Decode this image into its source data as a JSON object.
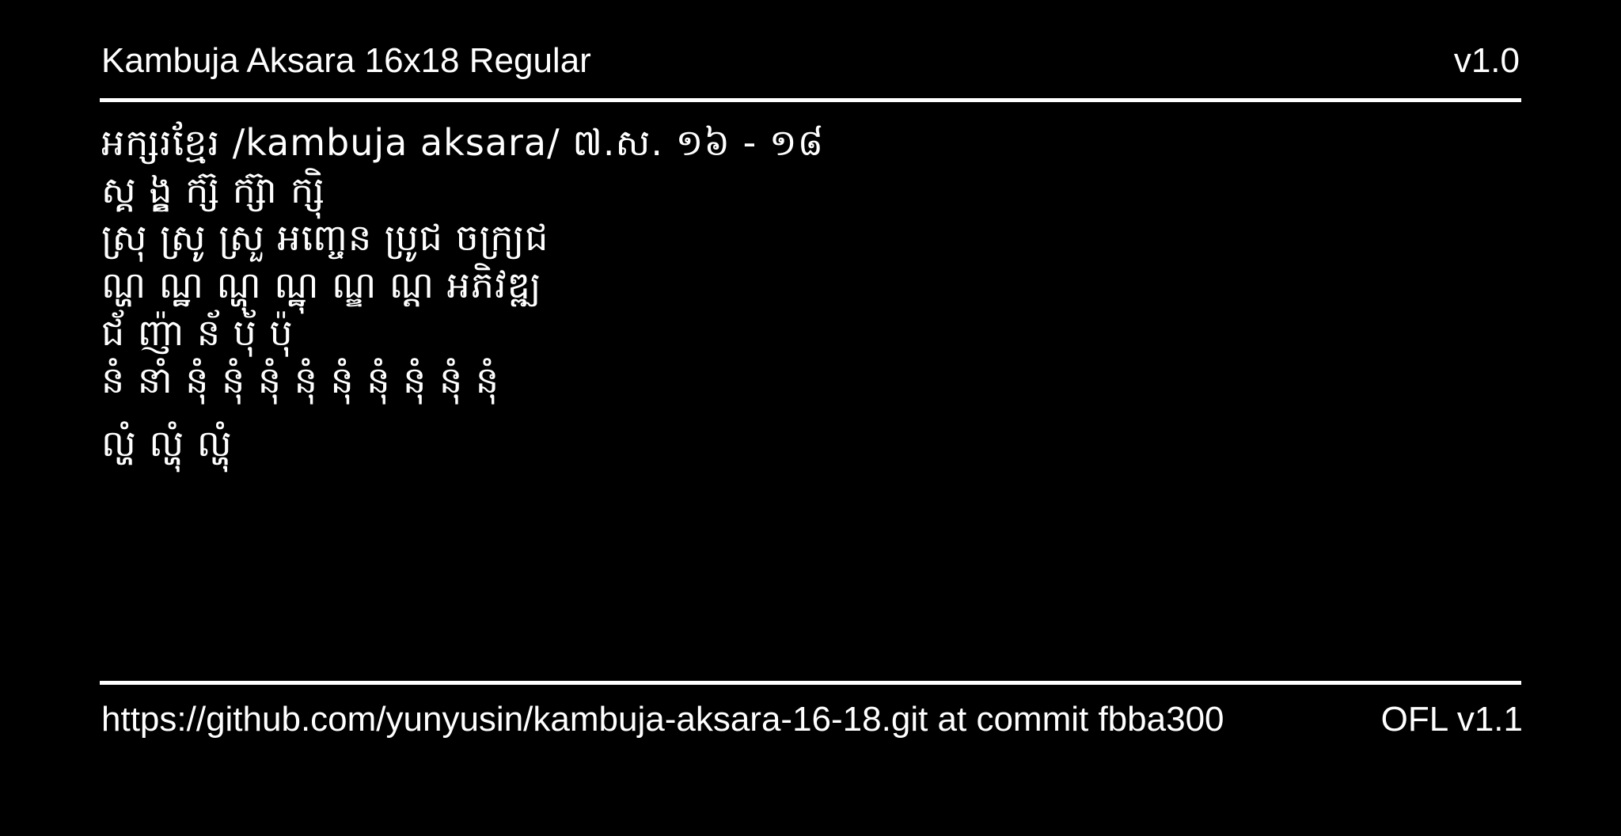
{
  "header": {
    "font_name": "Kambuja Aksara 16x18 Regular",
    "version": "v1.0"
  },
  "specimen": {
    "lines": [
      "អក្សរខ្មែរ /kambuja aksara/ ៧.ស. ១៦ - ១៨",
      "ស្គ្គ ង្ខ្គ ក្ស៊ ក្ស៊ា ក្ស៊ិ",
      "ស្រុ ស្រូ ស្រួ អញ្ចេន ប្រូជ ចក្រ្យជ",
      "ណ្ហ ណ្ឋ ណ្ហុ ណ្ឋុ ណ្ឌ ណ្ដ អភិវឌ្ឍ",
      "ជ័ ញ៉ា ន័ ប៉័ ប៉ុ",
      "នំ នាំ នុំ នុំ នុំ នុំ នុំ នុំ នុំ នុំ នុំ",
      "ល្ហំ ល្ហុំ ល្ហុំ"
    ]
  },
  "footer": {
    "repo": "https://github.com/yunyusin/kambuja-aksara-16-18.git at commit fbba300",
    "license": "OFL v1.1"
  },
  "colors": {
    "background": "#000000",
    "foreground": "#ffffff"
  }
}
